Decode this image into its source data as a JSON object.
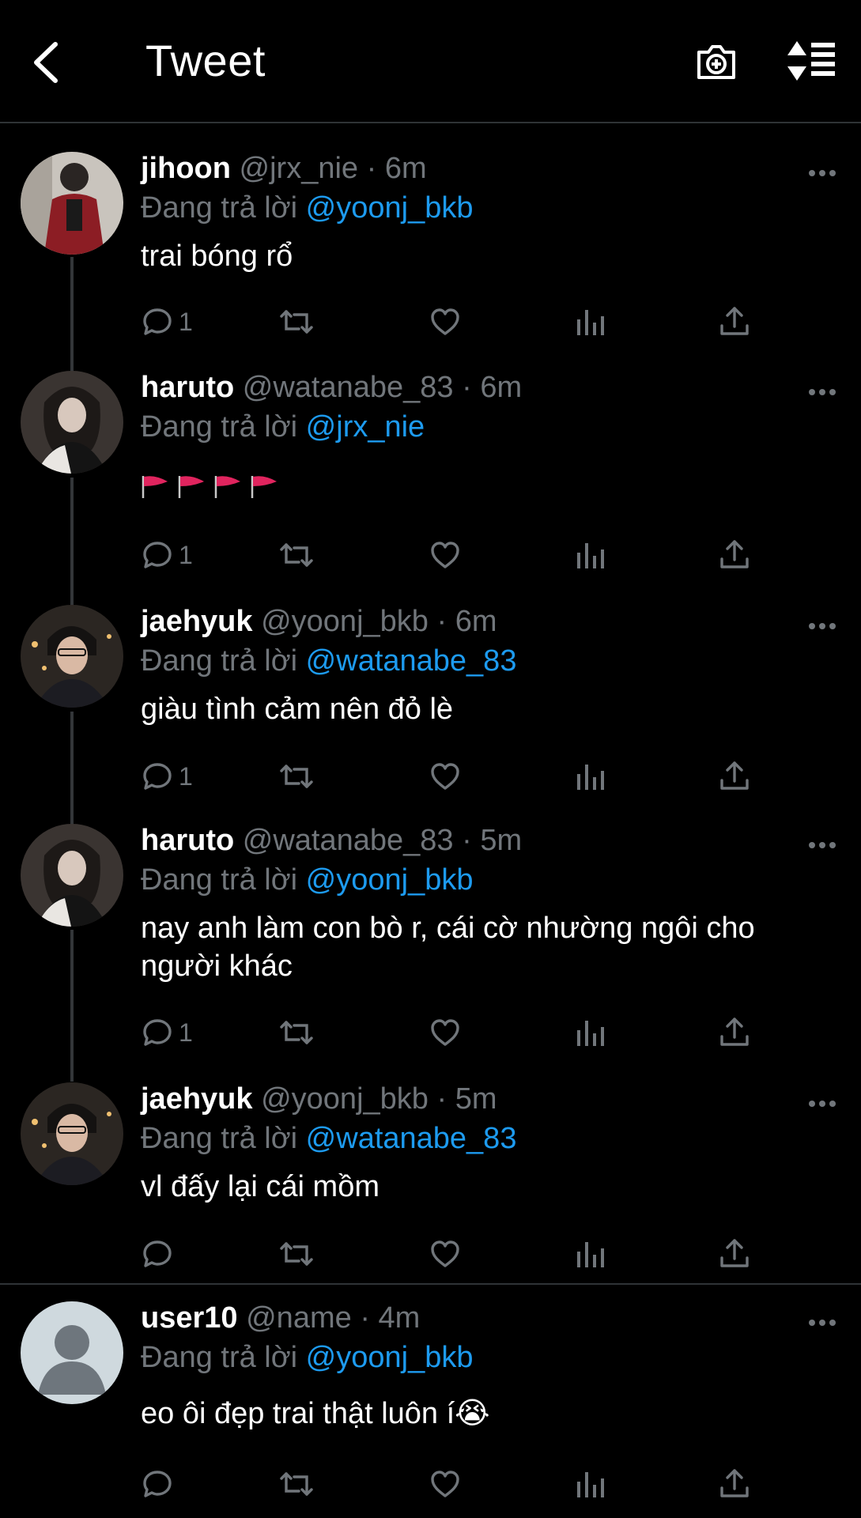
{
  "header": {
    "title": "Tweet",
    "back_icon": "chevron-left-icon",
    "camera_icon": "camera-plus-icon",
    "sort_icon": "sort-icon"
  },
  "tweets": [
    {
      "name": "jihoon",
      "handle": "@jrx_nie",
      "time": "6m",
      "reply_label": "Đang trả lời",
      "reply_to": "@yoonj_bkb",
      "text": "trai bóng rổ",
      "replies": "1"
    },
    {
      "name": "haruto",
      "handle": "@watanabe_83",
      "time": "6m",
      "reply_label": "Đang trả lời",
      "reply_to": "@jrx_nie",
      "text": "🚩🚩🚩🚩",
      "replies": "1"
    },
    {
      "name": "jaehyuk",
      "handle": "@yoonj_bkb",
      "time": "6m",
      "reply_label": "Đang trả lời",
      "reply_to": "@watanabe_83",
      "text": "giàu tình cảm nên đỏ lè",
      "replies": "1"
    },
    {
      "name": "haruto",
      "handle": "@watanabe_83",
      "time": "5m",
      "reply_label": "Đang trả lời",
      "reply_to": "@yoonj_bkb",
      "text": "nay anh làm con bò r, cái cờ nhường ngôi cho người khác",
      "replies": "1"
    },
    {
      "name": "jaehyuk",
      "handle": "@yoonj_bkb",
      "time": "5m",
      "reply_label": "Đang trả lời",
      "reply_to": "@watanabe_83",
      "text": "vl đấy lại cái mồm",
      "replies": ""
    },
    {
      "name": "user10",
      "handle": "@name",
      "time": "4m",
      "reply_label": "Đang trả lời",
      "reply_to": "@yoonj_bkb",
      "text": "eo ôi đẹp trai thật luôn í😭",
      "replies": ""
    }
  ],
  "separator": "·",
  "colors": {
    "background": "#000000",
    "accent": "#1d9bf0",
    "muted": "#71767b",
    "flag": "#e0245e"
  }
}
